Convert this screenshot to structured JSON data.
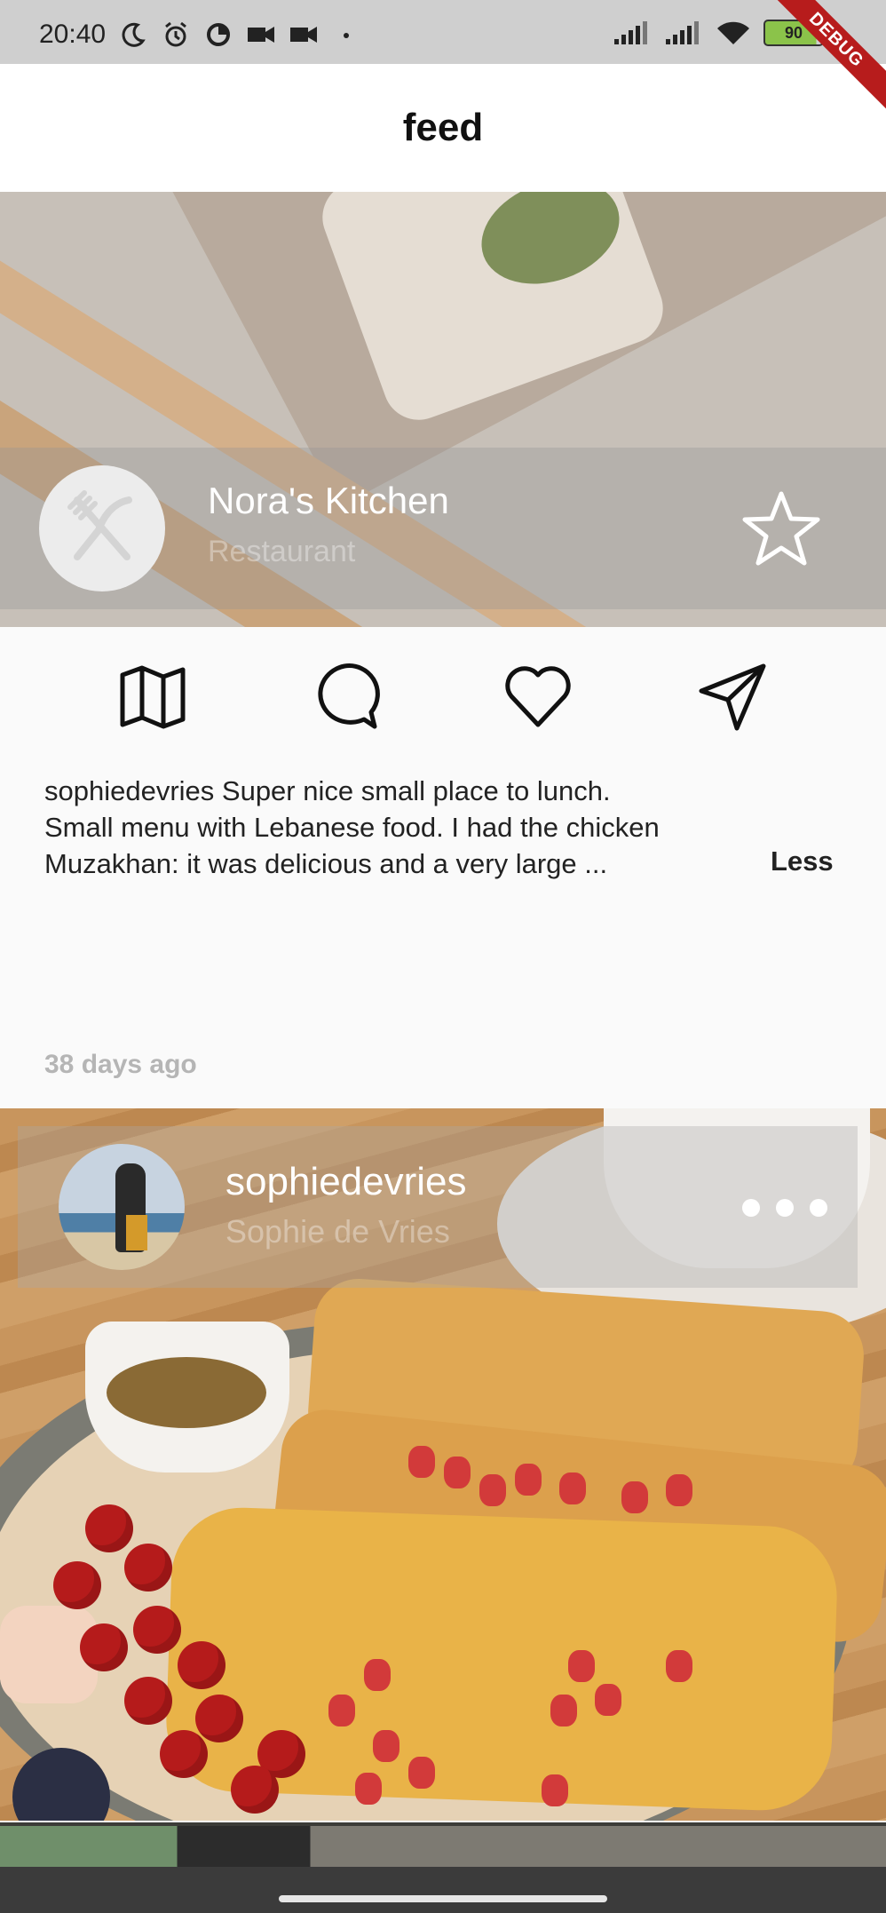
{
  "status_bar": {
    "time": "20:40",
    "icons_left": [
      "moon-icon",
      "alarm-icon",
      "data-saver-icon",
      "video-icon",
      "video-icon",
      "dot-icon"
    ],
    "icons_right": [
      "signal-icon",
      "signal-icon",
      "wifi-icon",
      "battery-icon"
    ],
    "battery_level": "90",
    "debug_label": "DEBUG"
  },
  "app_bar": {
    "title": "feed"
  },
  "post1": {
    "place_name": "Nora's Kitchen",
    "place_type": "Restaurant",
    "avatar_icon": "fork-knife-icon",
    "favorite_icon": "star-icon",
    "actions": [
      {
        "name": "map-icon"
      },
      {
        "name": "comment-icon"
      },
      {
        "name": "heart-icon"
      },
      {
        "name": "send-icon"
      }
    ],
    "caption_line1": "sophiedevries Super nice small place to lunch.",
    "caption_line2": "Small menu with Lebanese food. I had the chicken",
    "caption_line3": "Muzakhan: it was delicious and a very large ...",
    "toggle_label": "Less",
    "time_ago": "38 days ago"
  },
  "post2": {
    "username": "sophiedevries",
    "full_name": "Sophie de Vries",
    "more_icon": "more-horizontal-icon"
  },
  "colors": {
    "app_bar_bg": "#ffffff",
    "status_bar_bg": "#cfcfcf",
    "debug_ribbon": "#b71c1c",
    "muted_text": "#b5b5b5"
  }
}
